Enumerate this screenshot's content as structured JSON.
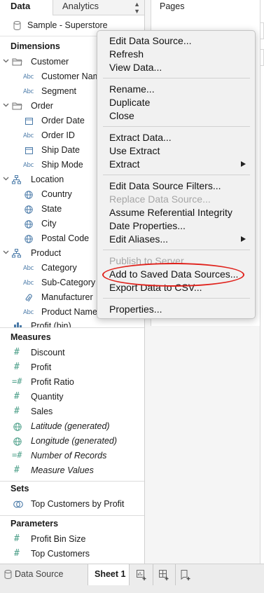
{
  "tabs": {
    "data_label": "Data",
    "analytics_label": "Analytics"
  },
  "data_source": {
    "name": "Sample - Superstore"
  },
  "dimensions": {
    "title": "Dimensions",
    "items": [
      {
        "label": "Customer",
        "kind": "folder"
      },
      {
        "label": "Customer Name",
        "kind": "abc"
      },
      {
        "label": "Segment",
        "kind": "abc"
      },
      {
        "label": "Order",
        "kind": "folder"
      },
      {
        "label": "Order Date",
        "kind": "date"
      },
      {
        "label": "Order ID",
        "kind": "abc"
      },
      {
        "label": "Ship Date",
        "kind": "date"
      },
      {
        "label": "Ship Mode",
        "kind": "abc"
      },
      {
        "label": "Location",
        "kind": "hierarchy"
      },
      {
        "label": "Country",
        "kind": "geo"
      },
      {
        "label": "State",
        "kind": "geo"
      },
      {
        "label": "City",
        "kind": "geo"
      },
      {
        "label": "Postal Code",
        "kind": "geo"
      },
      {
        "label": "Product",
        "kind": "hierarchy"
      },
      {
        "label": "Category",
        "kind": "abc"
      },
      {
        "label": "Sub-Category",
        "kind": "abc"
      },
      {
        "label": "Manufacturer",
        "kind": "clip"
      },
      {
        "label": "Product Name",
        "kind": "abc"
      },
      {
        "label": "Profit (bin)",
        "kind": "bin"
      }
    ]
  },
  "measures": {
    "title": "Measures",
    "items": [
      {
        "label": "Discount",
        "kind": "hash"
      },
      {
        "label": "Profit",
        "kind": "hash"
      },
      {
        "label": "Profit Ratio",
        "kind": "calc-hash"
      },
      {
        "label": "Quantity",
        "kind": "hash"
      },
      {
        "label": "Sales",
        "kind": "hash"
      },
      {
        "label": "Latitude (generated)",
        "kind": "geo"
      },
      {
        "label": "Longitude (generated)",
        "kind": "geo"
      },
      {
        "label": "Number of Records",
        "kind": "calc-hash"
      },
      {
        "label": "Measure Values",
        "kind": "hash"
      }
    ]
  },
  "sets": {
    "title": "Sets",
    "items": [
      {
        "label": "Top Customers by Profit",
        "kind": "set"
      }
    ]
  },
  "parameters": {
    "title": "Parameters",
    "items": [
      {
        "label": "Profit Bin Size",
        "kind": "hash"
      },
      {
        "label": "Top Customers",
        "kind": "hash"
      }
    ]
  },
  "pages_shelf": {
    "title": "Pages"
  },
  "context_menu": {
    "groups": [
      [
        {
          "label": "Edit Data Source...",
          "enabled": true
        },
        {
          "label": "Refresh",
          "enabled": true
        },
        {
          "label": "View Data...",
          "enabled": true
        }
      ],
      [
        {
          "label": "Rename...",
          "enabled": true
        },
        {
          "label": "Duplicate",
          "enabled": true
        },
        {
          "label": "Close",
          "enabled": true
        }
      ],
      [
        {
          "label": "Extract Data...",
          "enabled": true
        },
        {
          "label": "Use Extract",
          "enabled": true
        },
        {
          "label": "Extract",
          "enabled": true,
          "submenu": true
        }
      ],
      [
        {
          "label": "Edit Data Source Filters...",
          "enabled": true
        },
        {
          "label": "Replace Data Source...",
          "enabled": false
        },
        {
          "label": "Assume Referential Integrity",
          "enabled": true
        },
        {
          "label": "Date Properties...",
          "enabled": true
        },
        {
          "label": "Edit Aliases...",
          "enabled": true,
          "submenu": true
        }
      ],
      [
        {
          "label": "Publish to Server...",
          "enabled": false
        },
        {
          "label": "Add to Saved Data Sources...",
          "enabled": true,
          "highlighted": true
        },
        {
          "label": "Export Data to CSV...",
          "enabled": true
        }
      ],
      [
        {
          "label": "Properties...",
          "enabled": true
        }
      ]
    ]
  },
  "bottom_bar": {
    "data_source_label": "Data Source",
    "sheet_label": "Sheet 1"
  },
  "colors": {
    "dimension_icon": "#4a7aa8",
    "measure_icon": "#4ea08a",
    "highlight_ring": "#e0211b",
    "menu_background": "#f1f1f1"
  }
}
